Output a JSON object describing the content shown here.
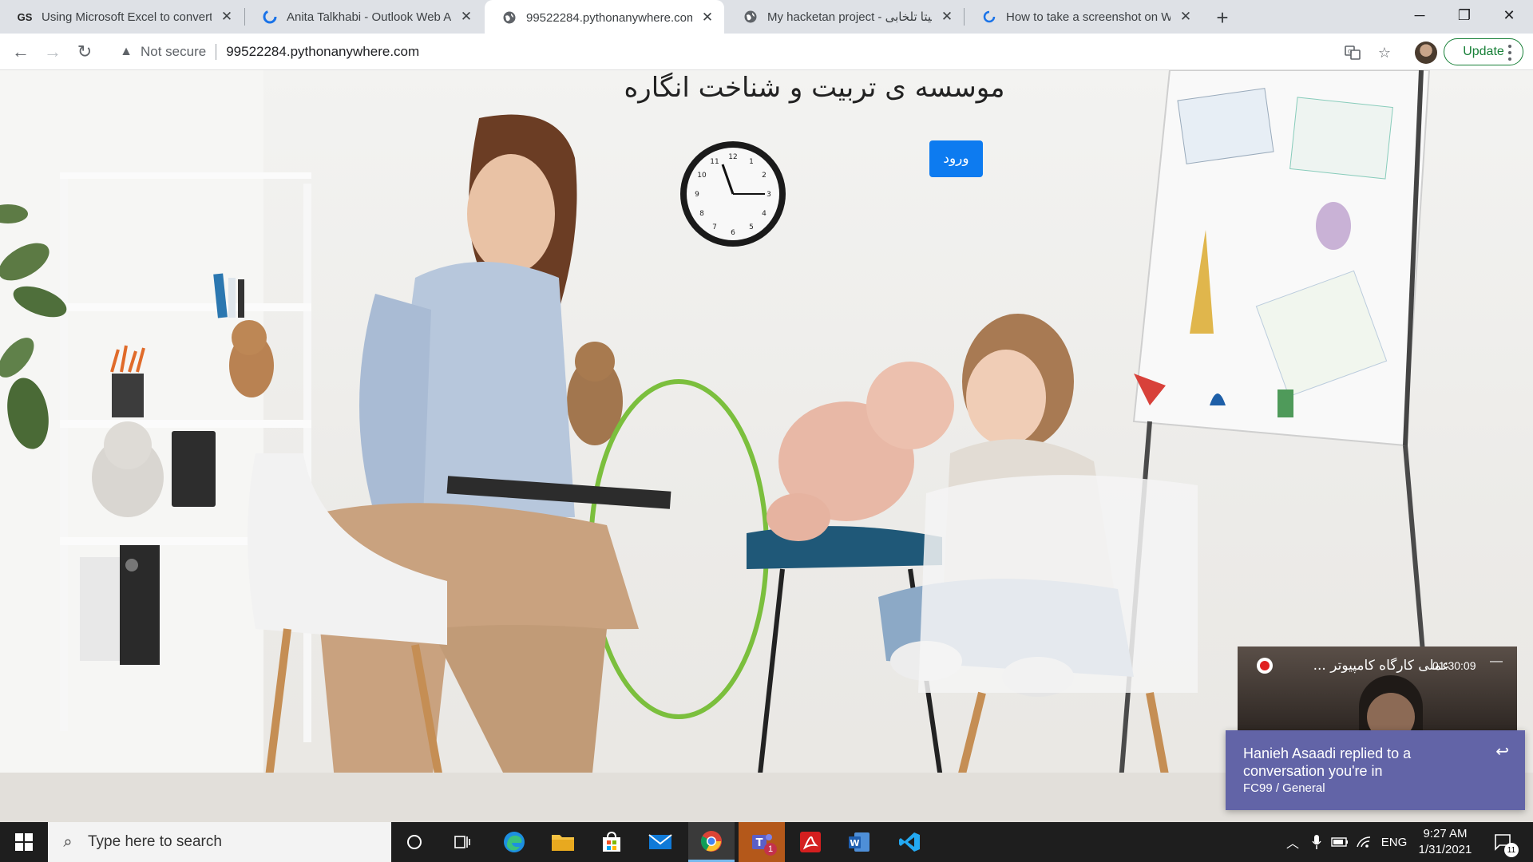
{
  "browser": {
    "tabs": [
      {
        "title": "Using Microsoft Excel to convert",
        "favicon": "GS",
        "active": false
      },
      {
        "title": "Anita Talkhabi - Outlook Web Ap",
        "favicon": "outlook-icon",
        "active": false
      },
      {
        "title": "99522284.pythonanywhere.com",
        "favicon": "globe-icon",
        "active": true
      },
      {
        "title": "My hacketan project - آنیتا تلخابی",
        "favicon": "globe-icon",
        "active": false
      },
      {
        "title": "How to take a screenshot on Win",
        "favicon": "loading-icon",
        "active": false
      }
    ],
    "security_label": "Not secure",
    "url": "99522284.pythonanywhere.com",
    "update_label": "Update"
  },
  "page": {
    "title": "موسسه ی تربیت و شناخت انگاره",
    "login_button": "ورود",
    "clock_numbers": [
      "12",
      "1",
      "2",
      "3",
      "4",
      "5",
      "6",
      "7",
      "8",
      "9",
      "10",
      "11"
    ]
  },
  "meeting": {
    "title": "عملی کارگاه کامپیوتر ...",
    "time": "01:30:09",
    "minimize": "—"
  },
  "toast": {
    "message": "Hanieh Asaadi replied to a conversation you're in",
    "subtitle": "FC99 / General"
  },
  "taskbar": {
    "search_placeholder": "Type here to search",
    "teams_badge": "1",
    "language": "ENG",
    "time": "9:27 AM",
    "date": "1/31/2021",
    "notification_count": "11"
  }
}
